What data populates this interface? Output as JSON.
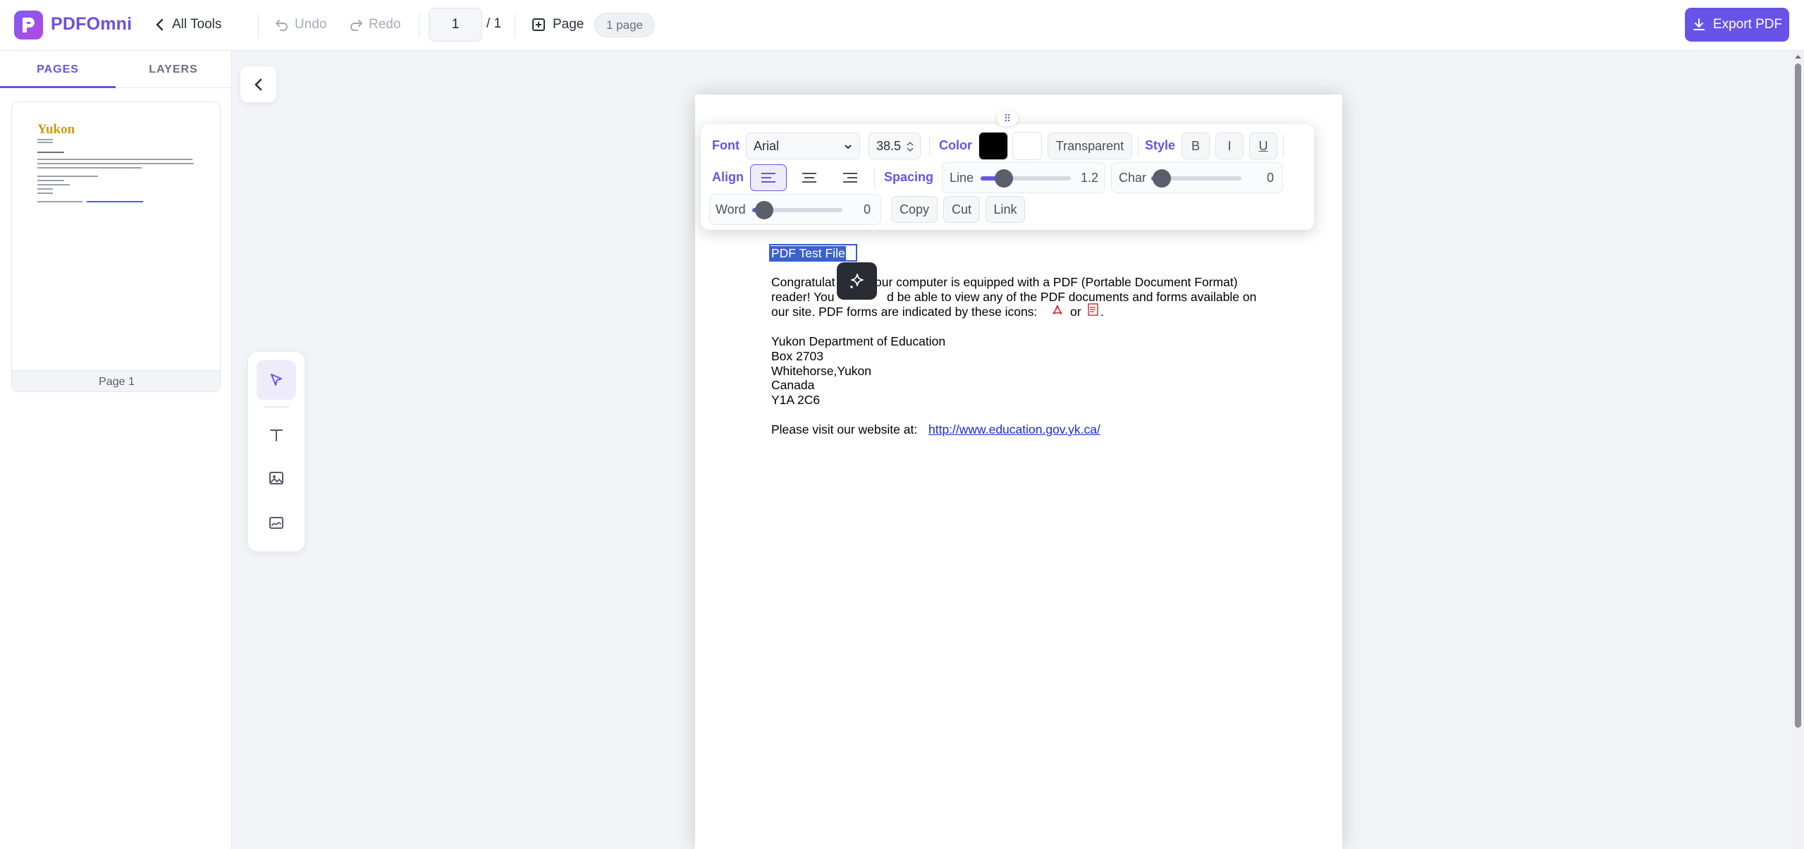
{
  "app": {
    "name": "PDFOmni"
  },
  "header": {
    "all_tools": "All Tools",
    "undo": "Undo",
    "redo": "Redo",
    "page_current": "1",
    "page_total": "/ 1",
    "add_page": "Page",
    "page_count": "1 page",
    "export": "Export PDF"
  },
  "sidebar": {
    "tabs": [
      "PAGES",
      "LAYERS"
    ],
    "thumbnails": [
      {
        "label": "Page 1"
      }
    ]
  },
  "format_toolbar": {
    "font_label": "Font",
    "font_family": "Arial",
    "font_size": "38.5",
    "color_label": "Color",
    "text_color": "#000000",
    "bg_color": "#ffffff",
    "transparent": "Transparent",
    "style_label": "Style",
    "bold": "B",
    "italic": "I",
    "underline": "U",
    "align_label": "Align",
    "alignment": "left",
    "spacing_label": "Spacing",
    "line_label": "Line",
    "line_value": "1.2",
    "char_label": "Char",
    "char_value": "0",
    "word_label": "Word",
    "word_value": "0",
    "copy": "Copy",
    "cut": "Cut",
    "link": "Link"
  },
  "document": {
    "title": "PDF Test File",
    "lines": [
      "Congratulat",
      "our computer is equipped with a PDF (Portable Document Format)",
      "reader!  You",
      "d be able to view any of the PDF documents and forms available on",
      "our site.  PDF forms are indicated by these icons:",
      "or",
      "Yukon Department of Education",
      "Box 2703",
      "Whitehorse,Yukon",
      "Canada",
      "Y1A 2C6",
      "Please visit our website at:"
    ],
    "link": "http://www.education.gov.yk.ca/",
    "thumb_logo": "Yukon"
  },
  "colors": {
    "accent": "#6754e6",
    "link": "#1a2ad8",
    "selection": "#3a63c9"
  }
}
